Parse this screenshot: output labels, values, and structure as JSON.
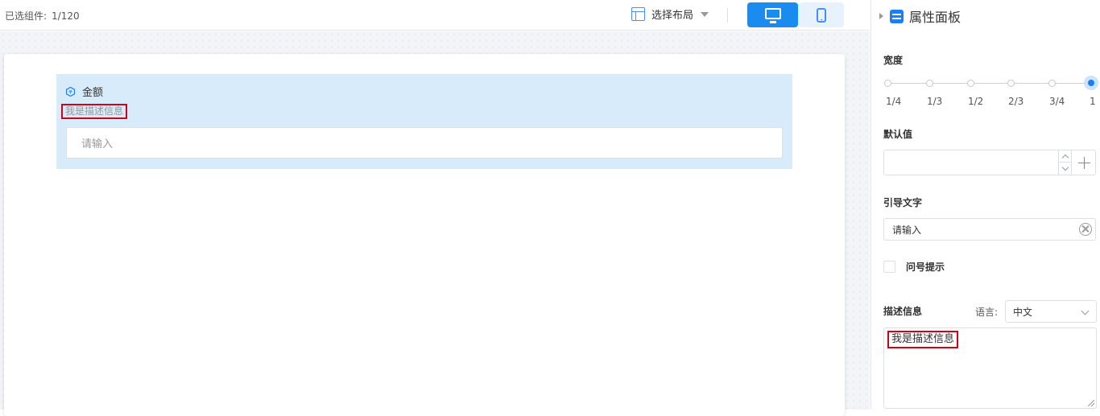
{
  "topbar": {
    "selected_label": "已选组件:",
    "selected_count": "1/120",
    "layout_label": "选择布局"
  },
  "canvas": {
    "component": {
      "title": "金额",
      "description": "我是描述信息",
      "placeholder": "请输入"
    }
  },
  "panel": {
    "title": "属性面板",
    "width": {
      "label": "宽度",
      "ticks": [
        "1/4",
        "1/3",
        "1/2",
        "2/3",
        "3/4",
        "1"
      ],
      "selected": "1"
    },
    "default_value": {
      "label": "默认值",
      "value": ""
    },
    "placeholder": {
      "label": "引导文字",
      "value": "请输入"
    },
    "tooltip": {
      "label": "问号提示",
      "checked": false
    },
    "description": {
      "label": "描述信息",
      "language_label": "语言:",
      "language_value": "中文",
      "value": "我是描述信息"
    }
  },
  "colors": {
    "primary": "#1a8cf0",
    "highlight": "#d8ebfb",
    "annotation": "#d0021b"
  }
}
